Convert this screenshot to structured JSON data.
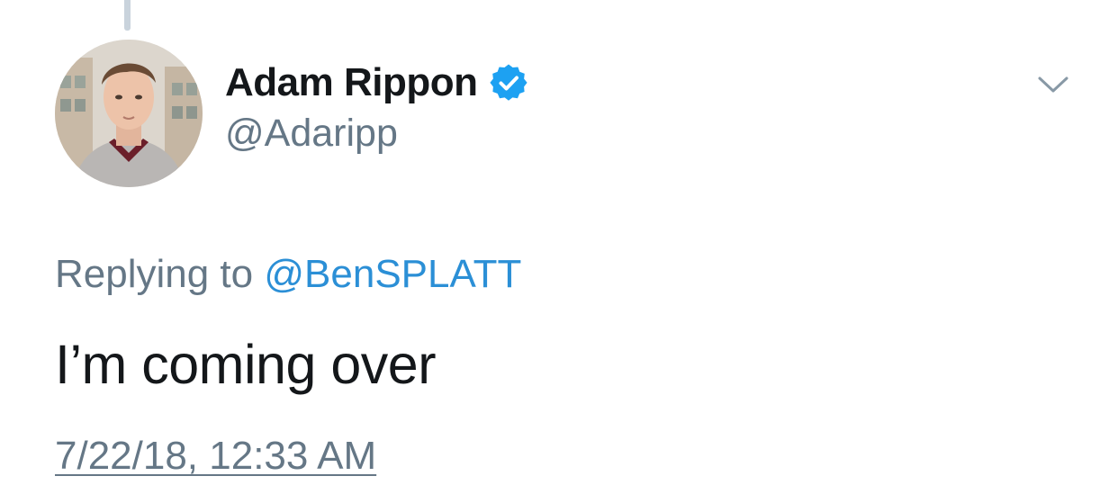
{
  "tweet": {
    "author": {
      "display_name": "Adam Rippon",
      "handle": "@Adaripp",
      "verified": true,
      "avatar_icon": "profile-photo"
    },
    "replying_prefix": "Replying to",
    "replying_to": "@BenSPLATT",
    "text": "I’m coming over",
    "timestamp": "7/22/18, 12:33 AM",
    "menu_icon": "chevron-down-icon"
  },
  "colors": {
    "primary_text": "#14171a",
    "secondary_text": "#657786",
    "link": "#2b8fd6",
    "verified_badge": "#1da1f2",
    "thread_line": "#c9d3dc"
  }
}
